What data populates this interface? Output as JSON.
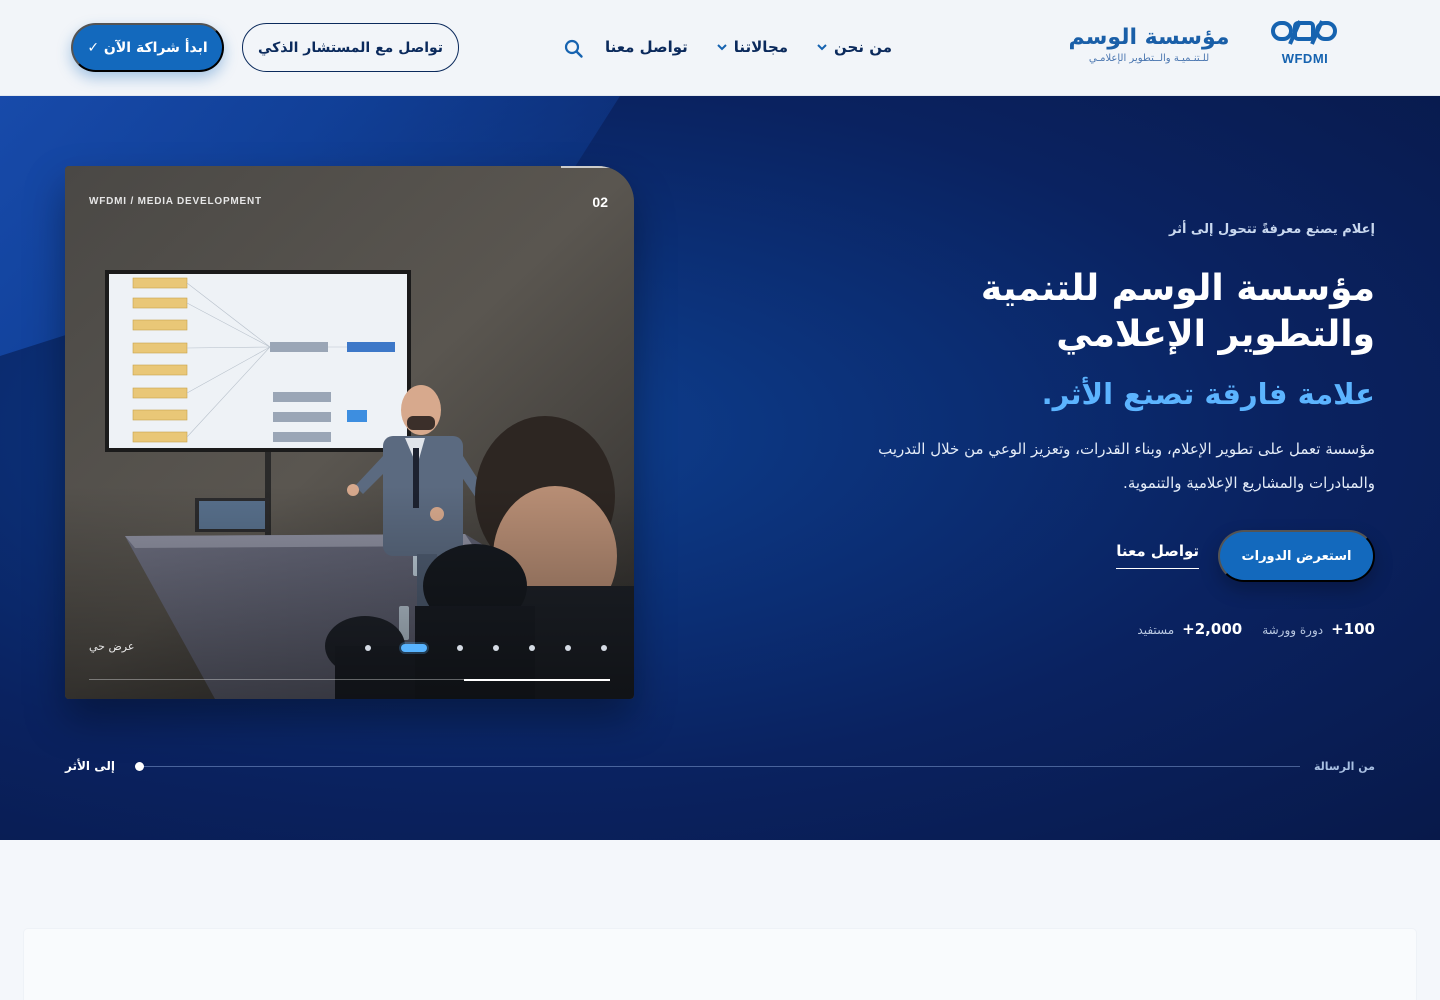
{
  "brand": {
    "name": "مؤسسة الوسم",
    "subtitle": "للـتنـميـة والــتطوير الإعلامـي",
    "code": "WFDMI",
    "color": "#1663b0"
  },
  "nav": {
    "items": [
      {
        "label": "من نحن",
        "has_dropdown": true
      },
      {
        "label": "مجالاتنا",
        "has_dropdown": true
      },
      {
        "label": "تواصل معنا",
        "has_dropdown": false
      }
    ],
    "search_icon": "search-icon",
    "advisor_button": "تواصل مع المستشار الذكي",
    "partner_button": "ابدأ شراكة الآن ✓"
  },
  "hero": {
    "eyebrow": "إعلام يصنع معرفةً تتحول إلى أثر",
    "title_line1": "مؤسسة الوسم للتنمية",
    "title_line2": "والتطوير الإعلامي",
    "tagline": "علامة فارقة تصنع الأثر.",
    "description": "مؤسسة تعمل على تطوير الإعلام، وبناء القدرات، وتعزيز الوعي من خلال التدريب والمبادرات والمشاريع الإعلامية والتنموية.",
    "primary_button": "استعرض الدورات",
    "secondary_link": "تواصل معنا",
    "stats": [
      {
        "value": "+100",
        "label": "دورة وورشة"
      },
      {
        "value": "+2,000",
        "label": "مستفيد"
      }
    ],
    "accent_color": "#5cb4ff"
  },
  "media_card": {
    "caption": "WFDMI / MEDIA DEVELOPMENT",
    "index": "02",
    "live_label": "عرض حي",
    "slide_count": 7,
    "active_slide": 2,
    "progress": 0.28
  },
  "timeline": {
    "start_label": "من الرسالة",
    "end_label": "إلى الأثر"
  }
}
